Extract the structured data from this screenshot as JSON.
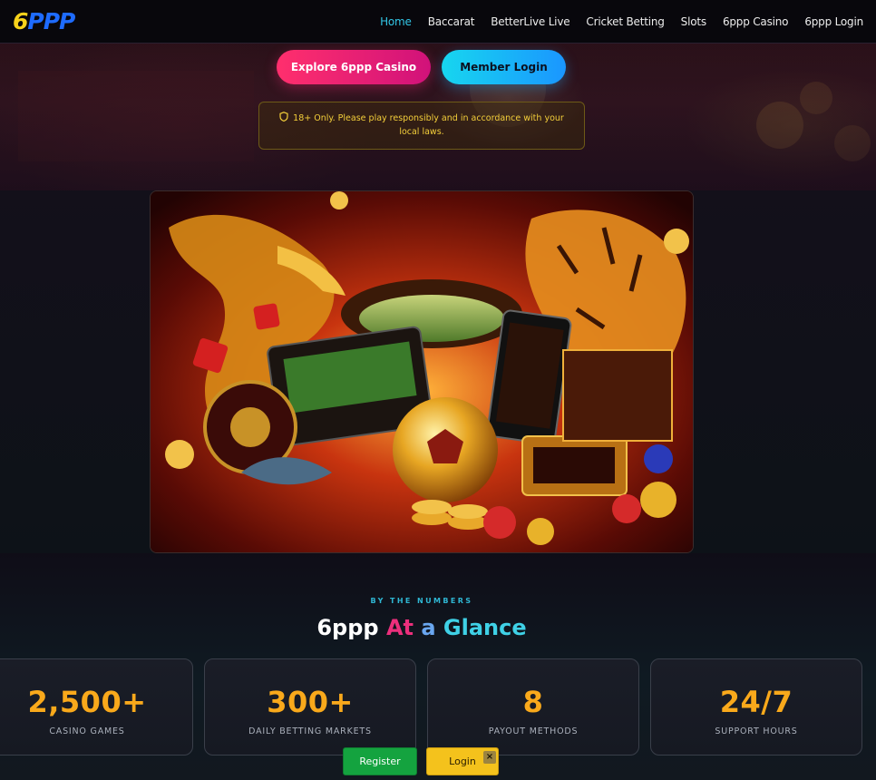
{
  "brand": {
    "logo_part1": "6",
    "logo_part2": "PPP"
  },
  "nav": {
    "items": [
      "Home",
      "Baccarat",
      "BetterLive Live",
      "Cricket Betting",
      "Slots",
      "6ppp Casino",
      "6ppp Login"
    ],
    "active": "Home",
    "active_color": "#32c6e6"
  },
  "hero": {
    "explore_label": "Explore 6ppp Casino",
    "member_label": "Member Login",
    "notice_text": "18+ Only. Please play responsibly and in accordance with your local laws.",
    "notice_icon": "shield-icon"
  },
  "stats": {
    "kicker": "BY THE NUMBERS",
    "title_part1": "6ppp",
    "title_part2": "At",
    "title_part3": "a",
    "title_part4": "Glance",
    "items": [
      {
        "number": "2,500+",
        "label": "CASINO GAMES"
      },
      {
        "number": "300+",
        "label": "DAILY BETTING MARKETS"
      },
      {
        "number": "8",
        "label": "PAYOUT METHODS"
      },
      {
        "number": "24/7",
        "label": "SUPPORT HOURS"
      }
    ]
  },
  "floating": {
    "register_label": "Register",
    "login_label": "Login",
    "close_label": "×"
  },
  "colors": {
    "accent_pink": "#ff2f6d",
    "accent_cyan": "#17d6ef",
    "stat_orange": "#f9a91b"
  }
}
